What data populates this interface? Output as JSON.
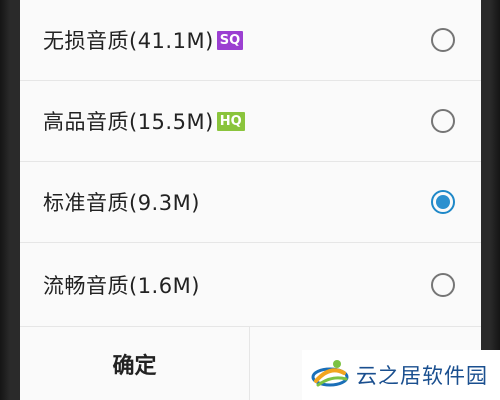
{
  "options": [
    {
      "label": "无损音质(41.1M)",
      "badge": "SQ",
      "badge_color": "#9b3fd1",
      "selected": false
    },
    {
      "label": "高品音质(15.5M)",
      "badge": "HQ",
      "badge_color": "#8ac43c",
      "selected": false
    },
    {
      "label": "标准音质(9.3M)",
      "badge": "",
      "selected": true
    },
    {
      "label": "流畅音质(1.6M)",
      "badge": "",
      "selected": false
    }
  ],
  "buttons": {
    "confirm_label": "确定",
    "cancel_label": ""
  },
  "watermark": {
    "text": "云之居软件园"
  },
  "colors": {
    "radio_selected": "#2b90cf",
    "text": "#222222"
  }
}
